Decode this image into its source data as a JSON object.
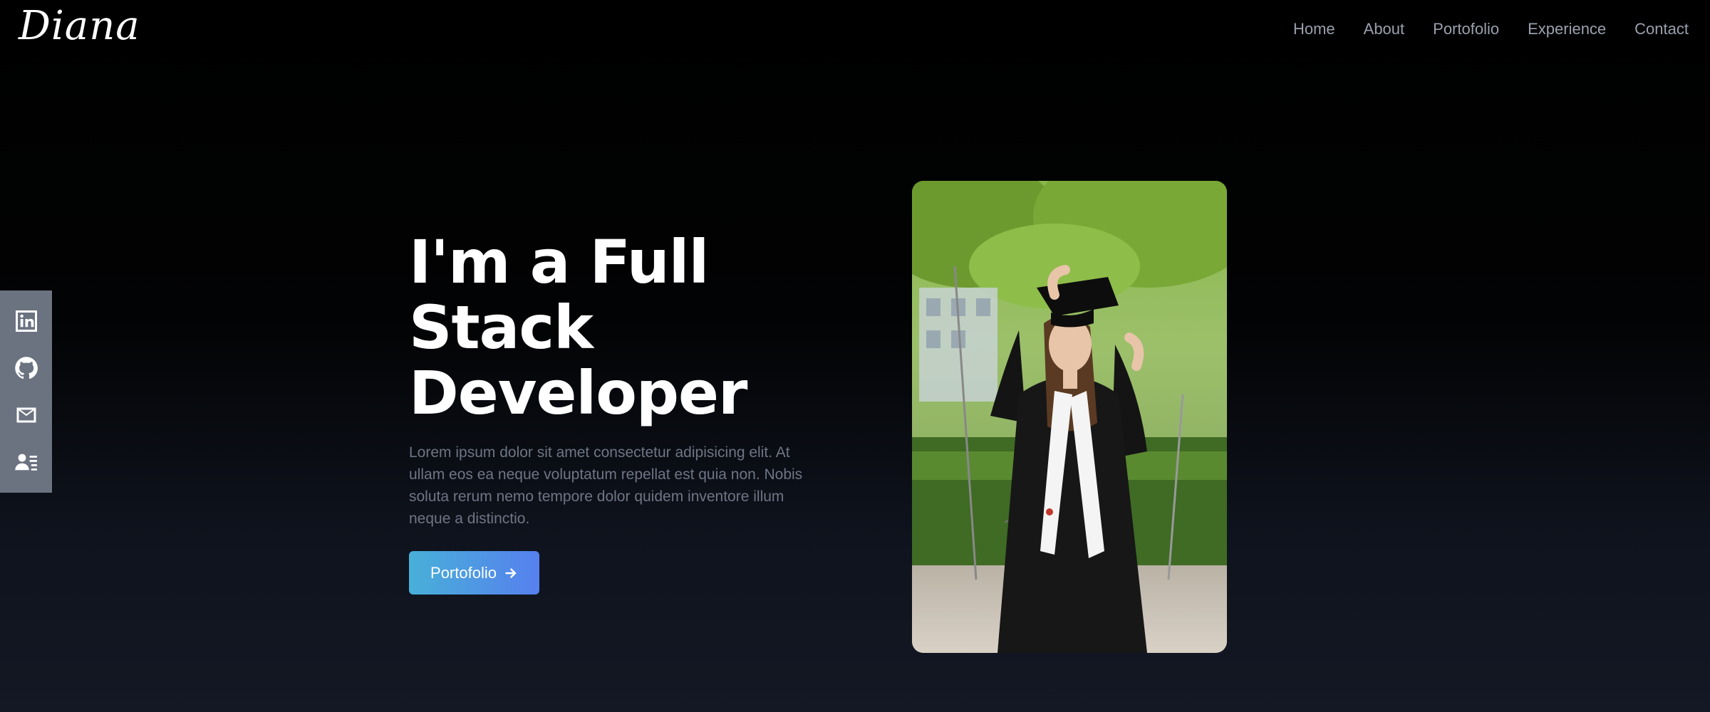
{
  "brand": {
    "logo": "Diana"
  },
  "nav": {
    "items": [
      {
        "label": "Home"
      },
      {
        "label": "About"
      },
      {
        "label": "Portofolio"
      },
      {
        "label": "Experience"
      },
      {
        "label": "Contact"
      }
    ]
  },
  "social": {
    "items": [
      {
        "icon": "linkedin-icon"
      },
      {
        "icon": "github-icon"
      },
      {
        "icon": "mail-icon"
      },
      {
        "icon": "resume-icon"
      }
    ]
  },
  "hero": {
    "title": "I'm a Full Stack Developer",
    "description": "Lorem ipsum dolor sit amet consectetur adipisicing elit. At ullam eos ea neque voluptatum repellat est quia non. Nobis soluta rerum nemo tempore dolor quidem inventore illum neque a distinctio.",
    "button_label": "Portofolio",
    "button_icon": "arrow-right-icon"
  },
  "colors": {
    "accent_start": "#48b0d8",
    "accent_end": "#5680ee",
    "nav_text": "#9aa0ad",
    "social_bar": "#6b7280"
  }
}
